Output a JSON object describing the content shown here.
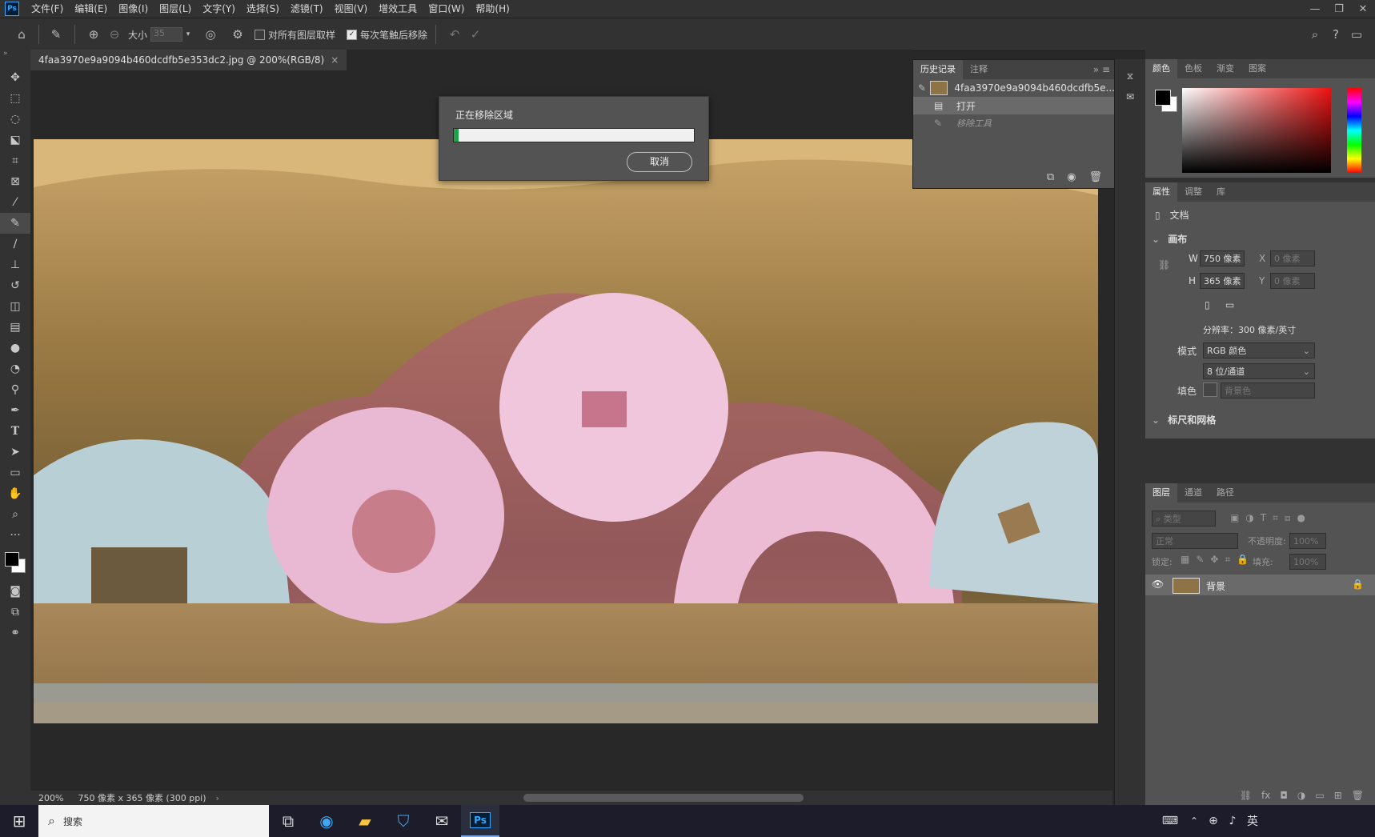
{
  "menubar": {
    "logo": "Ps",
    "items": [
      "文件(F)",
      "编辑(E)",
      "图像(I)",
      "图层(L)",
      "文字(Y)",
      "选择(S)",
      "滤镜(T)",
      "视图(V)",
      "增效工具",
      "窗口(W)",
      "帮助(H)"
    ]
  },
  "optbar": {
    "size_label": "大小",
    "size_value": "35",
    "sample_all_layers": "对所有图层取样",
    "remove_after_stroke": "每次笔触后移除"
  },
  "document": {
    "tab_title": "4faa3970e9a9094b460dcdfb5e353dc2.jpg @ 200%(RGB/8)"
  },
  "dialog": {
    "title": "正在移除区域",
    "progress": 0.02,
    "cancel_label": "取消"
  },
  "history": {
    "tabs": [
      "历史记录",
      "注释"
    ],
    "snapshot_name": "4faa3970e9a9094b460dcdfb5e...",
    "steps": [
      "打开",
      "移除工具"
    ]
  },
  "color_panel": {
    "tabs": [
      "颜色",
      "色板",
      "渐变",
      "图案"
    ]
  },
  "properties": {
    "tabs": [
      "属性",
      "调整",
      "库"
    ],
    "doc_label": "文档",
    "canvas_section": "画布",
    "w_label": "W",
    "w_value": "750 像素",
    "h_label": "H",
    "h_value": "365 像素",
    "x_label": "X",
    "x_value": "0 像素",
    "y_label": "Y",
    "y_value": "0 像素",
    "resolution": "分辨率：300 像素/英寸",
    "mode_label": "模式",
    "mode_value": "RGB 颜色",
    "depth_value": "8 位/通道",
    "fill_label": "填色",
    "fill_value": "背景色",
    "rulers_section": "标尺和网格"
  },
  "layers": {
    "tabs": [
      "图层",
      "通道",
      "路径"
    ],
    "filter_placeholder": "类型",
    "blend_mode": "正常",
    "opacity_label": "不透明度:",
    "opacity_value": "100%",
    "lock_label": "锁定:",
    "fill_label": "填充:",
    "fill_value": "100%",
    "layer_name": "背景"
  },
  "statusbar": {
    "zoom": "200%",
    "doc_info": "750 像素 x 365 像素 (300 ppi)"
  },
  "taskbar": {
    "search_placeholder": "搜索",
    "ime": "英",
    "ps_label": "Ps"
  },
  "colors": {
    "accent_progress": "#1fa34a",
    "ui_dark": "#323232",
    "panel": "#535353"
  }
}
